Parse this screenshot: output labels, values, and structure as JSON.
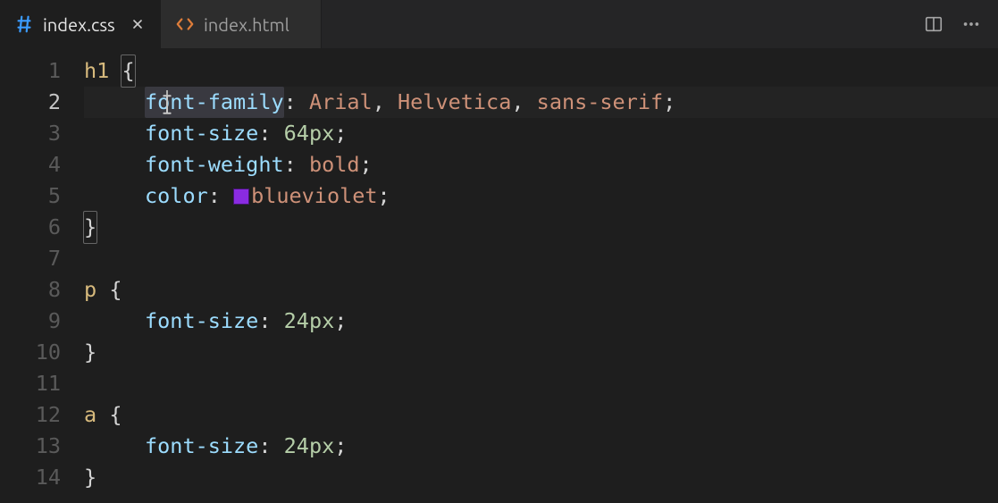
{
  "tabs": [
    {
      "label": "index.css",
      "icon": "css-hash-icon",
      "active": true,
      "dirty": false
    },
    {
      "label": "index.html",
      "icon": "html-brackets-icon",
      "active": false,
      "dirty": false
    }
  ],
  "actions": {
    "split_editor": "split-editor",
    "more": "more"
  },
  "editor": {
    "active_line": 2,
    "cursor": {
      "line": 2,
      "col": 7
    },
    "lines": [
      {
        "n": 1,
        "tokens": [
          {
            "t": "h1",
            "c": "sel"
          },
          {
            "t": " ",
            "c": "sp"
          },
          {
            "t": "{",
            "c": "brace",
            "box": true
          }
        ]
      },
      {
        "n": 2,
        "indent": 1,
        "highlight": true,
        "word_highlight": "font-family",
        "tokens": [
          {
            "t": "font-family",
            "c": "prop"
          },
          {
            "t": ":",
            "c": "punc"
          },
          {
            "t": " ",
            "c": "sp"
          },
          {
            "t": "Arial",
            "c": "val"
          },
          {
            "t": ",",
            "c": "punc"
          },
          {
            "t": " ",
            "c": "sp"
          },
          {
            "t": "Helvetica",
            "c": "val"
          },
          {
            "t": ",",
            "c": "punc"
          },
          {
            "t": " ",
            "c": "sp"
          },
          {
            "t": "sans-serif",
            "c": "val"
          },
          {
            "t": ";",
            "c": "punc"
          }
        ]
      },
      {
        "n": 3,
        "indent": 1,
        "tokens": [
          {
            "t": "font-size",
            "c": "prop"
          },
          {
            "t": ":",
            "c": "punc"
          },
          {
            "t": " ",
            "c": "sp"
          },
          {
            "t": "64",
            "c": "num"
          },
          {
            "t": "px",
            "c": "unit"
          },
          {
            "t": ";",
            "c": "punc"
          }
        ]
      },
      {
        "n": 4,
        "indent": 1,
        "tokens": [
          {
            "t": "font-weight",
            "c": "prop"
          },
          {
            "t": ":",
            "c": "punc"
          },
          {
            "t": " ",
            "c": "sp"
          },
          {
            "t": "bold",
            "c": "val"
          },
          {
            "t": ";",
            "c": "punc"
          }
        ]
      },
      {
        "n": 5,
        "indent": 1,
        "tokens": [
          {
            "t": "color",
            "c": "prop"
          },
          {
            "t": ":",
            "c": "punc"
          },
          {
            "t": " ",
            "c": "sp"
          },
          {
            "swatch": "#8a2be2"
          },
          {
            "t": "blueviolet",
            "c": "val"
          },
          {
            "t": ";",
            "c": "punc"
          }
        ]
      },
      {
        "n": 6,
        "indent": 0,
        "tokens": [
          {
            "t": "}",
            "c": "brace",
            "box": true
          }
        ]
      },
      {
        "n": 7,
        "tokens": []
      },
      {
        "n": 8,
        "tokens": [
          {
            "t": "p",
            "c": "sel"
          },
          {
            "t": " ",
            "c": "sp"
          },
          {
            "t": "{",
            "c": "brace"
          }
        ]
      },
      {
        "n": 9,
        "indent": 1,
        "tokens": [
          {
            "t": "font-size",
            "c": "prop"
          },
          {
            "t": ":",
            "c": "punc"
          },
          {
            "t": " ",
            "c": "sp"
          },
          {
            "t": "24",
            "c": "num"
          },
          {
            "t": "px",
            "c": "unit"
          },
          {
            "t": ";",
            "c": "punc"
          }
        ]
      },
      {
        "n": 10,
        "tokens": [
          {
            "t": "}",
            "c": "brace"
          }
        ]
      },
      {
        "n": 11,
        "tokens": []
      },
      {
        "n": 12,
        "tokens": [
          {
            "t": "a",
            "c": "sel"
          },
          {
            "t": " ",
            "c": "sp"
          },
          {
            "t": "{",
            "c": "brace"
          }
        ]
      },
      {
        "n": 13,
        "indent": 1,
        "tokens": [
          {
            "t": "font-size",
            "c": "prop"
          },
          {
            "t": ":",
            "c": "punc"
          },
          {
            "t": " ",
            "c": "sp"
          },
          {
            "t": "24",
            "c": "num"
          },
          {
            "t": "px",
            "c": "unit"
          },
          {
            "t": ";",
            "c": "punc"
          }
        ]
      },
      {
        "n": 14,
        "tokens": [
          {
            "t": "}",
            "c": "brace"
          }
        ]
      }
    ]
  },
  "colors": {
    "css_icon": "#3b9cff",
    "html_icon": "#de7d3a"
  }
}
